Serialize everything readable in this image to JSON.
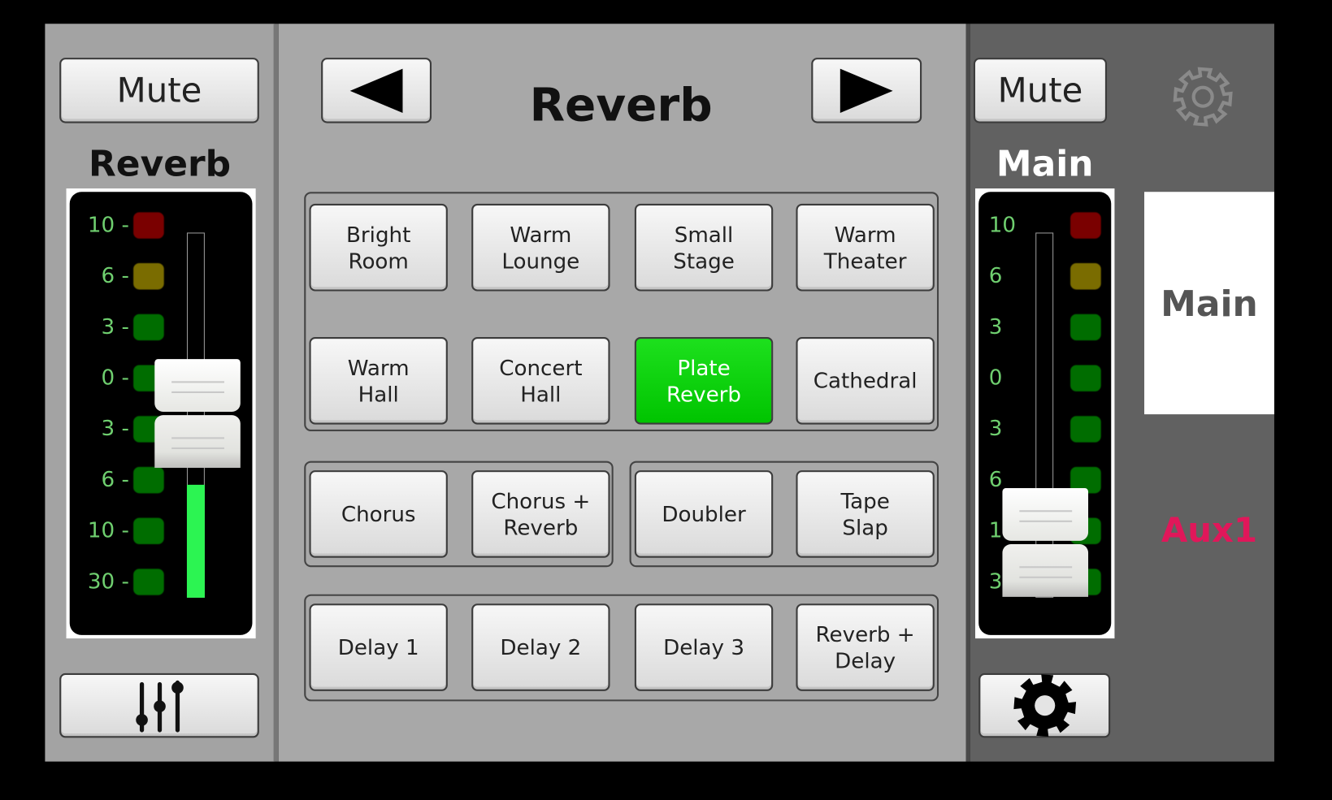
{
  "left_strip": {
    "mute_label": "Mute",
    "channel_name": "Reverb",
    "meter_ticks": [
      "10 -",
      "6 -",
      "3 -",
      "0 -",
      "3 -",
      "6 -",
      "10 -",
      "30 -"
    ],
    "signal_level": 0.31,
    "fader_icon": "mixer-sliders-icon"
  },
  "center": {
    "prev_icon": "triangle-left-icon",
    "next_icon": "triangle-right-icon",
    "title": "Reverb",
    "presets": [
      {
        "label": "Bright\nRoom",
        "selected": false
      },
      {
        "label": "Warm\nLounge",
        "selected": false
      },
      {
        "label": "Small\nStage",
        "selected": false
      },
      {
        "label": "Warm\nTheater",
        "selected": false
      },
      {
        "label": "Warm\nHall",
        "selected": false
      },
      {
        "label": "Concert\nHall",
        "selected": false
      },
      {
        "label": "Plate\nReverb",
        "selected": true
      },
      {
        "label": "Cathedral",
        "selected": false
      },
      {
        "label": "Chorus",
        "selected": false
      },
      {
        "label": "Chorus +\nReverb",
        "selected": false
      },
      {
        "label": "Doubler",
        "selected": false
      },
      {
        "label": "Tape\nSlap",
        "selected": false
      },
      {
        "label": "Delay 1",
        "selected": false
      },
      {
        "label": "Delay 2",
        "selected": false
      },
      {
        "label": "Delay 3",
        "selected": false
      },
      {
        "label": "Reverb +\nDelay",
        "selected": false
      }
    ]
  },
  "right_strip": {
    "mute_label": "Mute",
    "channel_name": "Main",
    "meter_ticks": [
      "10",
      "6",
      "3",
      "0",
      "3",
      "6",
      "10",
      "30"
    ],
    "settings_icon": "gear-icon"
  },
  "side_tabs": {
    "main": "Main",
    "aux1": "Aux1"
  },
  "colors": {
    "selected": "#00cc00",
    "aux_accent": "#e0175a",
    "meter_text": "#6fcf6f",
    "led_red": "#7a0000",
    "led_yellow": "#7a6c00",
    "led_green": "#006d00"
  }
}
